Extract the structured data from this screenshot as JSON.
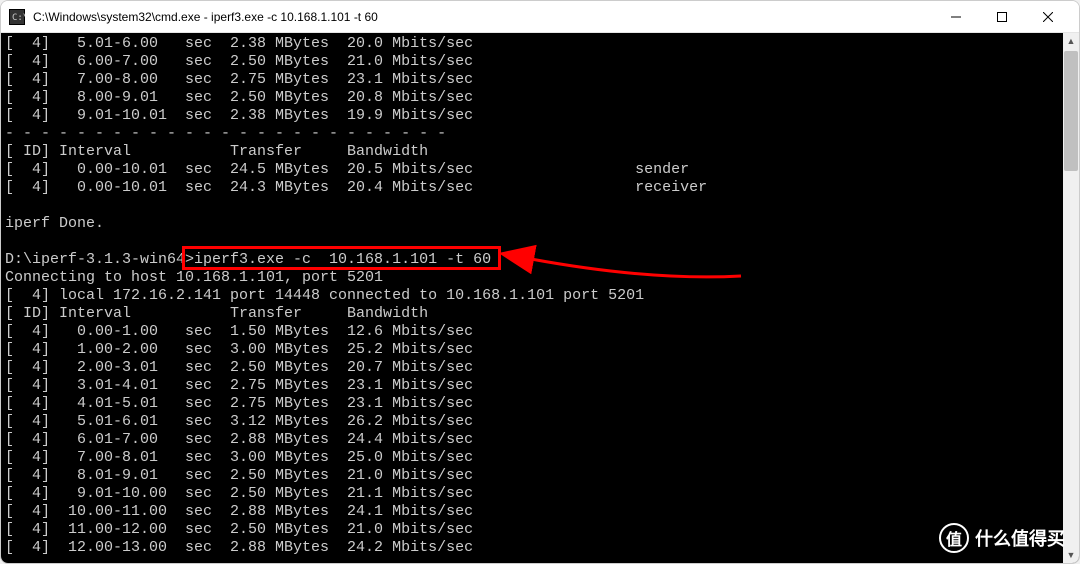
{
  "window": {
    "title": "C:\\Windows\\system32\\cmd.exe - iperf3.exe  -c  10.168.1.101 -t 60"
  },
  "terminal": {
    "lines": [
      "[  4]   5.01-6.00   sec  2.38 MBytes  20.0 Mbits/sec",
      "[  4]   6.00-7.00   sec  2.50 MBytes  21.0 Mbits/sec",
      "[  4]   7.00-8.00   sec  2.75 MBytes  23.1 Mbits/sec",
      "[  4]   8.00-9.01   sec  2.50 MBytes  20.8 Mbits/sec",
      "[  4]   9.01-10.01  sec  2.38 MBytes  19.9 Mbits/sec",
      "- - - - - - - - - - - - - - - - - - - - - - - - -",
      "[ ID] Interval           Transfer     Bandwidth",
      "[  4]   0.00-10.01  sec  24.5 MBytes  20.5 Mbits/sec                  sender",
      "[  4]   0.00-10.01  sec  24.3 MBytes  20.4 Mbits/sec                  receiver",
      "",
      "iperf Done.",
      "",
      "D:\\iperf-3.1.3-win64>iperf3.exe -c  10.168.1.101 -t 60",
      "Connecting to host 10.168.1.101, port 5201",
      "[  4] local 172.16.2.141 port 14448 connected to 10.168.1.101 port 5201",
      "[ ID] Interval           Transfer     Bandwidth",
      "[  4]   0.00-1.00   sec  1.50 MBytes  12.6 Mbits/sec",
      "[  4]   1.00-2.00   sec  3.00 MBytes  25.2 Mbits/sec",
      "[  4]   2.00-3.01   sec  2.50 MBytes  20.7 Mbits/sec",
      "[  4]   3.01-4.01   sec  2.75 MBytes  23.1 Mbits/sec",
      "[  4]   4.01-5.01   sec  2.75 MBytes  23.1 Mbits/sec",
      "[  4]   5.01-6.01   sec  3.12 MBytes  26.2 Mbits/sec",
      "[  4]   6.01-7.00   sec  2.88 MBytes  24.4 Mbits/sec",
      "[  4]   7.00-8.01   sec  3.00 MBytes  25.0 Mbits/sec",
      "[  4]   8.01-9.01   sec  2.50 MBytes  21.0 Mbits/sec",
      "[  4]   9.01-10.00  sec  2.50 MBytes  21.1 Mbits/sec",
      "[  4]  10.00-11.00  sec  2.88 MBytes  24.1 Mbits/sec",
      "[  4]  11.00-12.00  sec  2.50 MBytes  21.0 Mbits/sec",
      "[  4]  12.00-13.00  sec  2.88 MBytes  24.2 Mbits/sec"
    ]
  },
  "annotation": {
    "highlight_command": "iperf3.exe -c  10.168.1.101 -t 60"
  },
  "watermark": {
    "symbol": "值",
    "text": "什么值得买"
  }
}
